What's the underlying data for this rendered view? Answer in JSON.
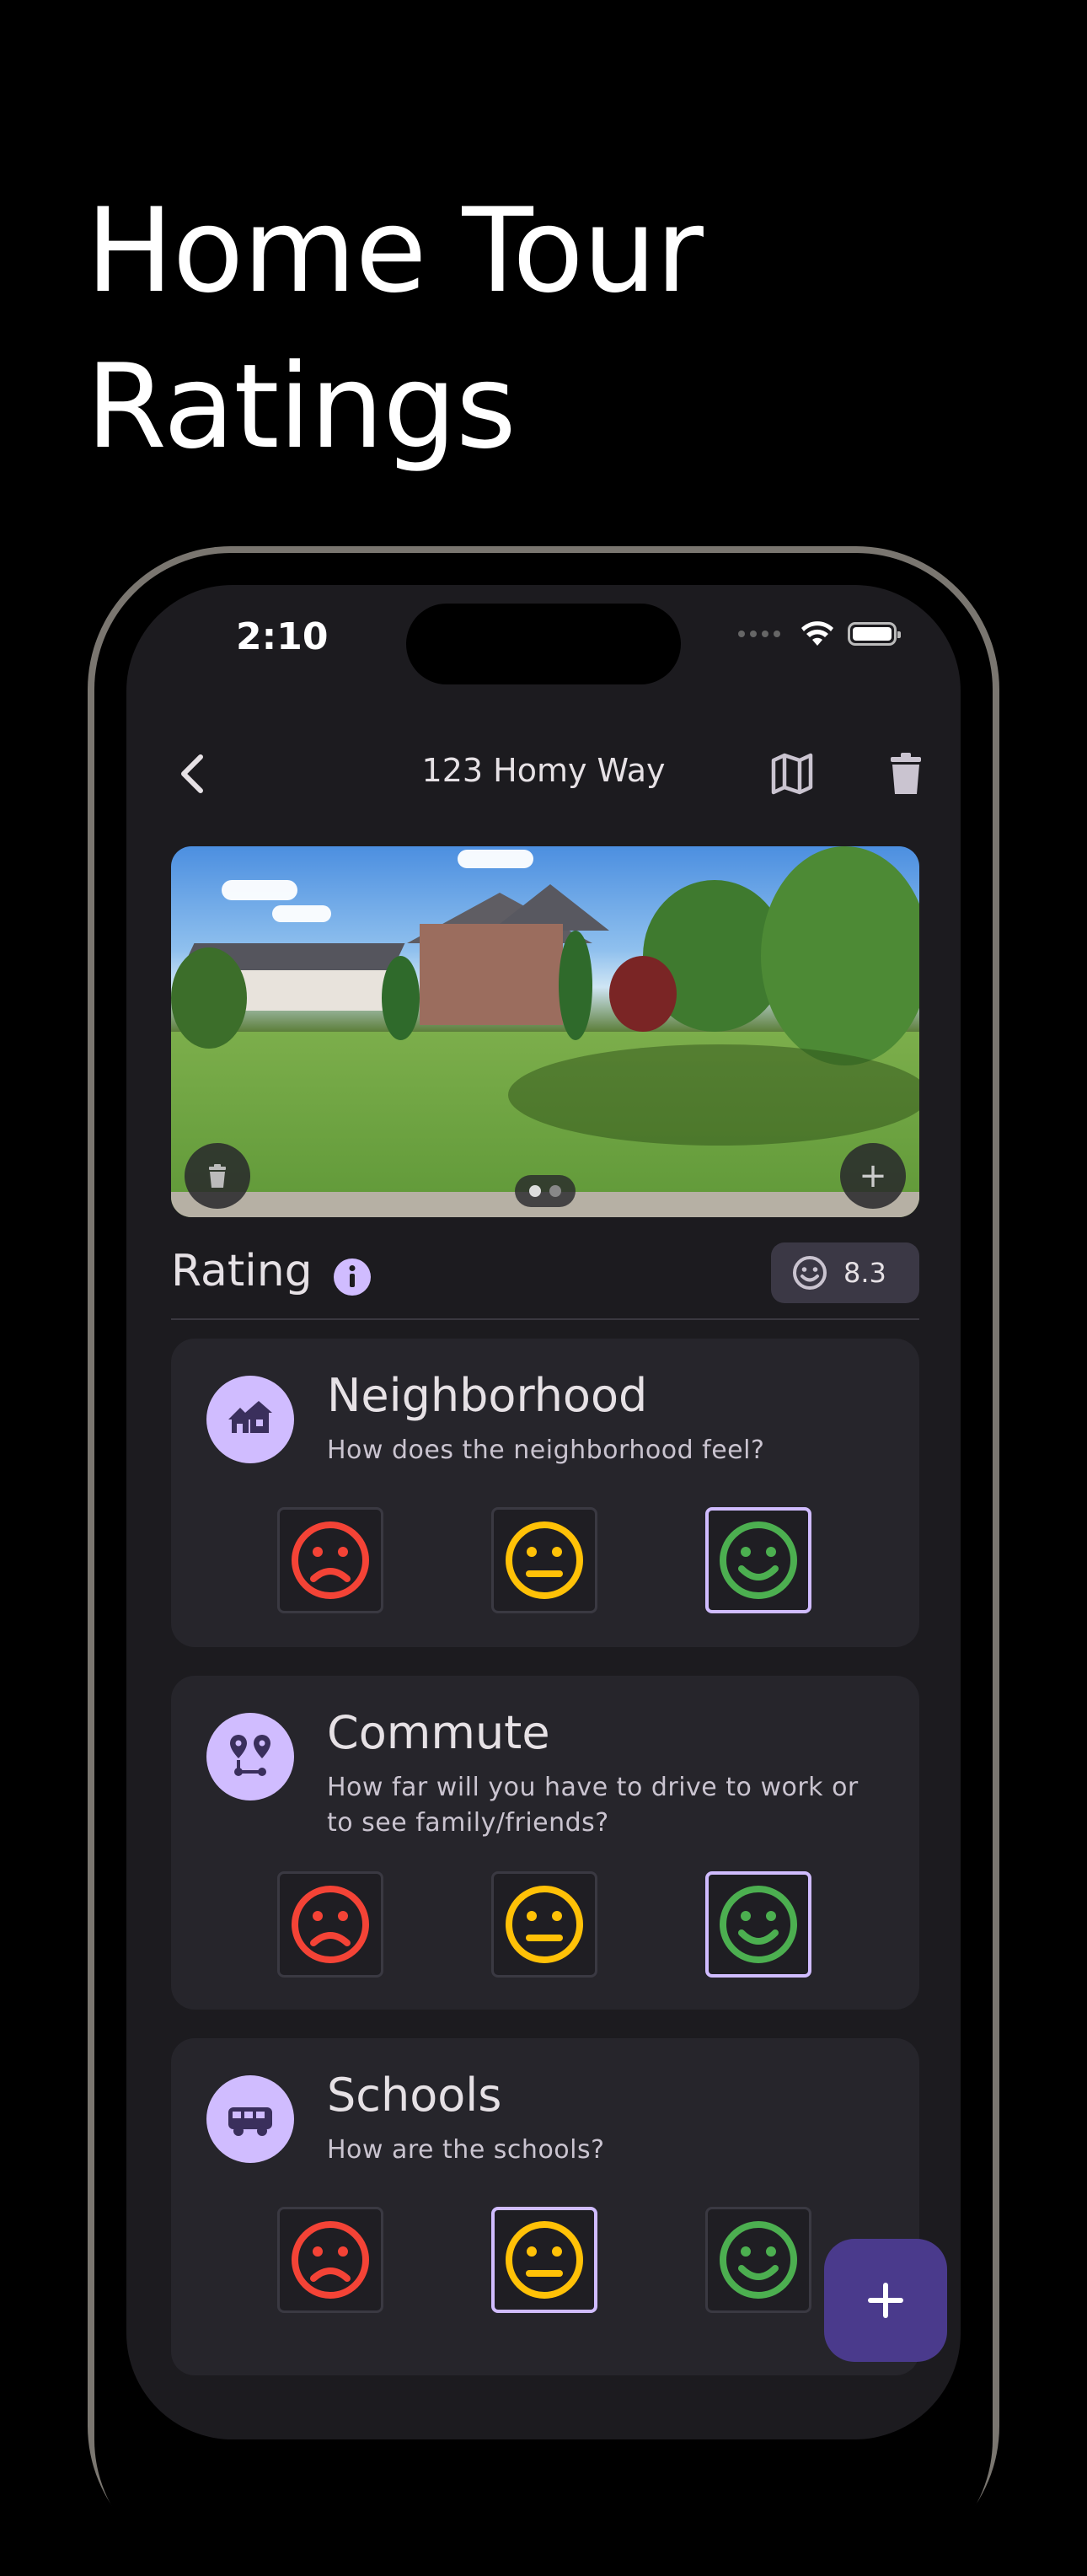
{
  "hero": {
    "line1": "Home Tour",
    "line2": "Ratings"
  },
  "status_bar": {
    "time": "2:10"
  },
  "appbar": {
    "title": "123 Homy Way"
  },
  "photo": {
    "page_count": 2,
    "current_page": 1
  },
  "rating": {
    "label": "Rating",
    "score": "8.3"
  },
  "colors": {
    "accent": "#d0bcff",
    "bad": "#f44336",
    "neutral": "#ffc107",
    "good": "#4caf50",
    "fab": "#4a3a8c"
  },
  "cards": [
    {
      "icon": "neighborhood-icon",
      "title": "Neighborhood",
      "subtitle": "How does the neighborhood feel?",
      "selected": "good"
    },
    {
      "icon": "commute-icon",
      "title": "Commute",
      "subtitle": "How far will you have to drive to work or to see family/friends?",
      "selected": "good"
    },
    {
      "icon": "bus-icon",
      "title": "Schools",
      "subtitle": "How are the schools?",
      "selected": "neutral"
    }
  ]
}
